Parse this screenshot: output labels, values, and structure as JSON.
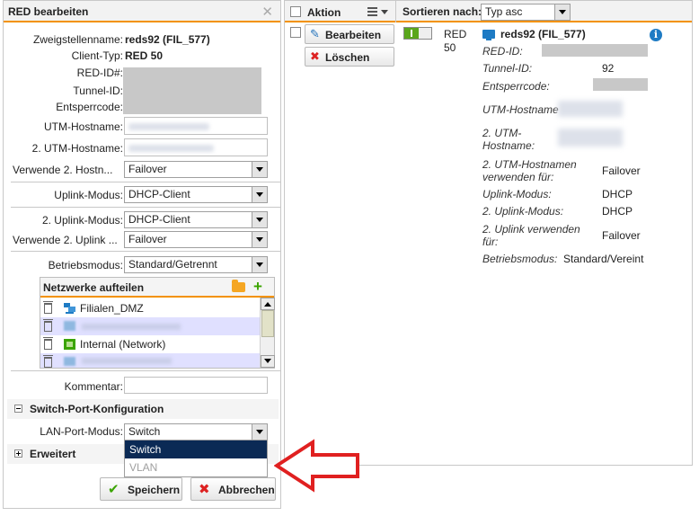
{
  "dialog": {
    "title": "RED bearbeiten",
    "close_icon": "close-icon",
    "fields": {
      "branch_name_label": "Zweigstellenname:",
      "branch_name_value": "reds92 (FIL_577)",
      "client_type_label": "Client-Typ:",
      "client_type_value": "RED 50",
      "red_id_label": "RED-ID#:",
      "tunnel_id_label": "Tunnel-ID:",
      "unlock_code_label": "Entsperrcode:",
      "utm_hostname_label": "UTM-Hostname:",
      "utm_hostname2_label": "2. UTM-Hostname:",
      "use_hostname2_label": "Verwende 2. Hostn...",
      "use_hostname2_value": "Failover",
      "uplink_mode_label": "Uplink-Modus:",
      "uplink_mode_value": "DHCP-Client",
      "uplink_mode2_label": "2. Uplink-Modus:",
      "uplink_mode2_value": "DHCP-Client",
      "use_uplink2_label": "Verwende 2. Uplink ...",
      "use_uplink2_value": "Failover",
      "operation_mode_label": "Betriebsmodus:",
      "operation_mode_value": "Standard/Getrennt",
      "comment_label": "Kommentar:"
    },
    "networks": {
      "title": "Netzwerke aufteilen",
      "items": [
        {
          "label": "Filialen_DMZ",
          "icon": "network-group-icon"
        },
        {
          "label": "",
          "icon": "network-group-icon"
        },
        {
          "label": "Internal (Network)",
          "icon": "network-icon"
        },
        {
          "label": "",
          "icon": "network-group-icon"
        }
      ]
    },
    "switch_section": {
      "title": "Switch-Port-Konfiguration",
      "lan_port_label": "LAN-Port-Modus:",
      "lan_port_value": "Switch",
      "options": [
        "Switch",
        "VLAN"
      ]
    },
    "advanced_section": {
      "title": "Erweitert"
    },
    "save_label": "Speichern",
    "cancel_label": "Abbrechen"
  },
  "list_panel": {
    "header": {
      "action_label": "Aktion",
      "sort_label": "Sortieren nach:",
      "sort_value": "Typ asc"
    },
    "row": {
      "edit_label": "Bearbeiten",
      "delete_label": "Löschen",
      "type": "RED",
      "type_num": "50",
      "name": "reds92 (FIL_577)",
      "details": {
        "red_id_label": "RED-ID:",
        "tunnel_id_label": "Tunnel-ID:",
        "tunnel_id_value": "92",
        "unlock_code_label": "Entsperrcode:",
        "utm_hostname_label": "UTM-Hostname",
        "utm_hostname2_label": "2. UTM-Hostname:",
        "utm_hostnames_use_label": "2. UTM-Hostnamen verwenden für:",
        "utm_hostnames_use_value": "Failover",
        "uplink_mode_label": "Uplink-Modus:",
        "uplink_mode_value": "DHCP",
        "uplink_mode2_label": "2. Uplink-Modus:",
        "uplink_mode2_value": "DHCP",
        "uplink2_use_label": "2. Uplink verwenden für:",
        "uplink2_use_value": "Failover",
        "operation_mode_label": "Betriebsmodus:",
        "operation_mode_value": "Standard/Vereint"
      }
    }
  },
  "colors": {
    "accent_orange": "#f39200",
    "selection_navy": "#0b2a55",
    "arrow_red": "#e02020",
    "toggle_green": "#5aa61c",
    "info_blue": "#1e7bc4"
  }
}
